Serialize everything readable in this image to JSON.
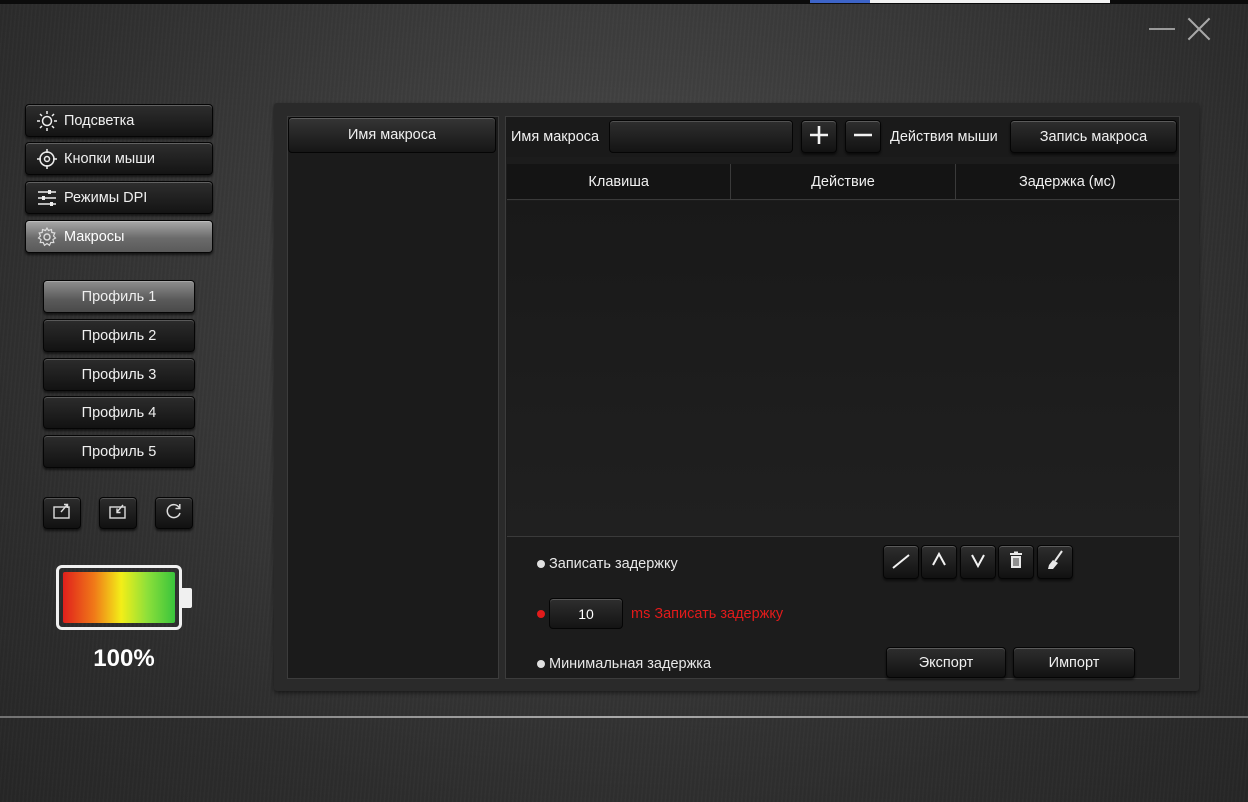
{
  "window": {
    "minimize_icon": "minimize-icon",
    "close_icon": "close-icon"
  },
  "nav": {
    "items": [
      {
        "label": "Подсветка",
        "icon": "sun-icon",
        "active": false
      },
      {
        "label": "Кнопки мыши",
        "icon": "crosshair-icon",
        "active": false
      },
      {
        "label": "Режимы DPI",
        "icon": "sliders-icon",
        "active": false
      },
      {
        "label": "Макросы",
        "icon": "gear-icon",
        "active": true
      }
    ]
  },
  "profiles": {
    "items": [
      {
        "label": "Профиль 1",
        "active": true
      },
      {
        "label": "Профиль 2",
        "active": false
      },
      {
        "label": "Профиль 3",
        "active": false
      },
      {
        "label": "Профиль 4",
        "active": false
      },
      {
        "label": "Профиль 5",
        "active": false
      }
    ],
    "actions": [
      "export-profile-icon",
      "import-profile-icon",
      "reset-icon"
    ]
  },
  "battery": {
    "level_percent": 100,
    "text": "100%"
  },
  "macro_list": {
    "header": "Имя макроса"
  },
  "editor": {
    "name_label": "Имя макроса",
    "name_value": "",
    "add_icon": "plus-icon",
    "remove_icon": "minus-icon",
    "mouse_actions_label": "Действия мыши",
    "record_label": "Запись макроса",
    "columns": [
      "Клавиша",
      "Действие",
      "Задержка (мс)"
    ],
    "rows": []
  },
  "delay_options": {
    "record_delay": "Записать задержку",
    "fixed_delay_value": "10",
    "fixed_delay_label": "ms Записать задержку",
    "min_delay": "Минимальная задержка",
    "selected": "fixed"
  },
  "row_tools": [
    "edit-icon",
    "move-up-icon",
    "move-down-icon",
    "delete-icon",
    "clear-icon"
  ],
  "footer": {
    "export_label": "Экспорт",
    "import_label": "Импорт"
  },
  "colors": {
    "accent_red": "#e21b1b",
    "active_button": "#8e8e8e"
  }
}
